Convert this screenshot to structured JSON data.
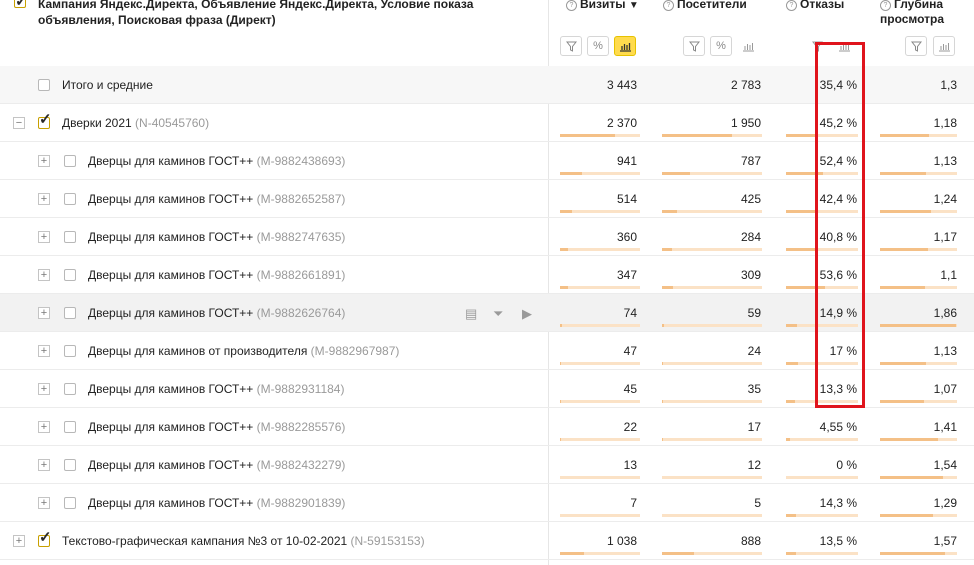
{
  "header": {
    "title": "Кампания Яндекс.Директа, Объявление Яндекс.Директа, Условие показа объявления, Поисковая фраза (Директ)"
  },
  "columns": [
    {
      "label": "Визиты",
      "sort_arrow": "▼"
    },
    {
      "label": "Посетители"
    },
    {
      "label": "Отказы"
    },
    {
      "label": "Глубина просмотра"
    }
  ],
  "toolbar_icons": {
    "filter": "filter-icon",
    "percent": "%",
    "bars": "bar-chart-icon"
  },
  "rows": [
    {
      "label": "Итого и средние",
      "id": "",
      "values": [
        "3 443",
        "2 783",
        "35,4 %",
        "1,3"
      ],
      "bars": [
        0,
        0,
        0,
        0
      ]
    },
    {
      "label": "Дверки 2021",
      "id": "(N-40545760)",
      "values": [
        "2 370",
        "1 950",
        "45,2 %",
        "1,18"
      ],
      "bars": [
        0.69,
        0.7,
        0.45,
        0.63
      ]
    },
    {
      "label": "Дверцы для каминов ГОСТ++",
      "id": "(M-9882438693)",
      "values": [
        "941",
        "787",
        "52,4 %",
        "1,13"
      ],
      "bars": [
        0.27,
        0.28,
        0.52,
        0.6
      ]
    },
    {
      "label": "Дверцы для каминов ГОСТ++",
      "id": "(M-9882652587)",
      "values": [
        "514",
        "425",
        "42,4 %",
        "1,24"
      ],
      "bars": [
        0.15,
        0.15,
        0.42,
        0.66
      ]
    },
    {
      "label": "Дверцы для каминов ГОСТ++",
      "id": "(M-9882747635)",
      "values": [
        "360",
        "284",
        "40,8 %",
        "1,17"
      ],
      "bars": [
        0.1,
        0.1,
        0.41,
        0.62
      ]
    },
    {
      "label": "Дверцы для каминов ГОСТ++",
      "id": "(M-9882661891)",
      "values": [
        "347",
        "309",
        "53,6 %",
        "1,1"
      ],
      "bars": [
        0.1,
        0.11,
        0.54,
        0.59
      ]
    },
    {
      "label": "Дверцы для каминов ГОСТ++",
      "id": "(M-9882626764)",
      "values": [
        "74",
        "59",
        "14,9 %",
        "1,86"
      ],
      "bars": [
        0.02,
        0.02,
        0.15,
        0.99
      ]
    },
    {
      "label": "Дверцы для каминов от производителя",
      "id": "(M-9882967987)",
      "values": [
        "47",
        "24",
        "17 %",
        "1,13"
      ],
      "bars": [
        0.01,
        0.01,
        0.17,
        0.6
      ]
    },
    {
      "label": "Дверцы для каминов ГОСТ++",
      "id": "(M-9882931184)",
      "values": [
        "45",
        "35",
        "13,3 %",
        "1,07"
      ],
      "bars": [
        0.01,
        0.01,
        0.13,
        0.57
      ]
    },
    {
      "label": "Дверцы для каминов ГОСТ++",
      "id": "(M-9882285576)",
      "values": [
        "22",
        "17",
        "4,55 %",
        "1,41"
      ],
      "bars": [
        0.01,
        0.01,
        0.05,
        0.75
      ]
    },
    {
      "label": "Дверцы для каминов ГОСТ++",
      "id": "(M-9882432279)",
      "values": [
        "13",
        "12",
        "0 %",
        "1,54"
      ],
      "bars": [
        0.0,
        0.0,
        0.0,
        0.82
      ]
    },
    {
      "label": "Дверцы для каминов ГОСТ++",
      "id": "(M-9882901839)",
      "values": [
        "7",
        "5",
        "14,3 %",
        "1,29"
      ],
      "bars": [
        0.0,
        0.0,
        0.14,
        0.69
      ]
    },
    {
      "label": "Текстово-графическая кампания №3 от 10-02-2021",
      "id": "(N-59153153)",
      "values": [
        "1 038",
        "888",
        "13,5 %",
        "1,57"
      ],
      "bars": [
        0.3,
        0.32,
        0.14,
        0.84
      ]
    }
  ],
  "row_actions": [
    "save-icon",
    "filter-icon",
    "play-icon"
  ],
  "colors": {
    "bar_fill": "#f4c087",
    "bar_track": "#fbe2c6",
    "highlight_border": "#e0141c",
    "active_button": "#ffdb4d"
  }
}
